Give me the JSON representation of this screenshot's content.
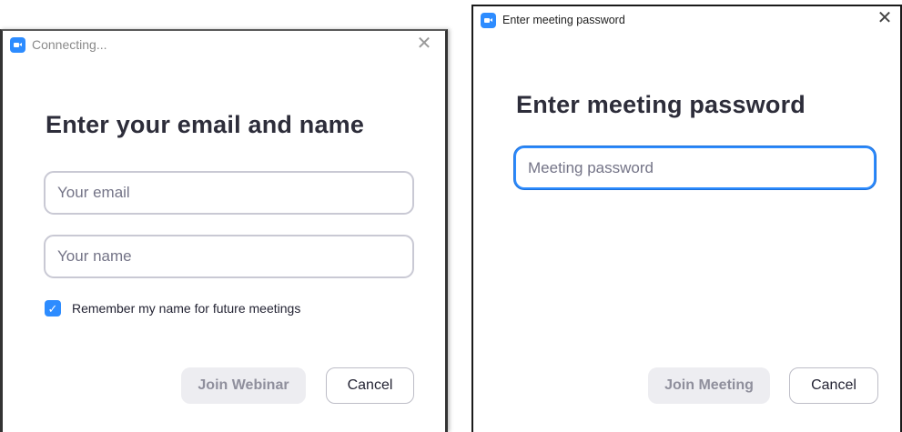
{
  "email_dialog": {
    "window_title": "Connecting...",
    "close_glyph": "✕",
    "heading": "Enter your email and name",
    "email_placeholder": "Your email",
    "name_placeholder": "Your name",
    "remember_checked": true,
    "remember_label": "Remember my name for future meetings",
    "primary_button": "Join Webinar",
    "cancel_button": "Cancel"
  },
  "password_dialog": {
    "window_title": "Enter meeting password",
    "close_glyph": "✕",
    "heading": "Enter meeting password",
    "password_placeholder": "Meeting password",
    "primary_button": "Join Meeting",
    "cancel_button": "Cancel"
  },
  "icons": {
    "app_icon": "zoom-camera-icon",
    "close_icon": "close-icon",
    "check_icon": "checkmark-icon"
  },
  "colors": {
    "accent": "#2d8cff",
    "heading": "#2d2d3a",
    "disabled_bg": "#ededf1",
    "disabled_text": "#8f8f9c",
    "field_border": "#c9c9d4"
  }
}
